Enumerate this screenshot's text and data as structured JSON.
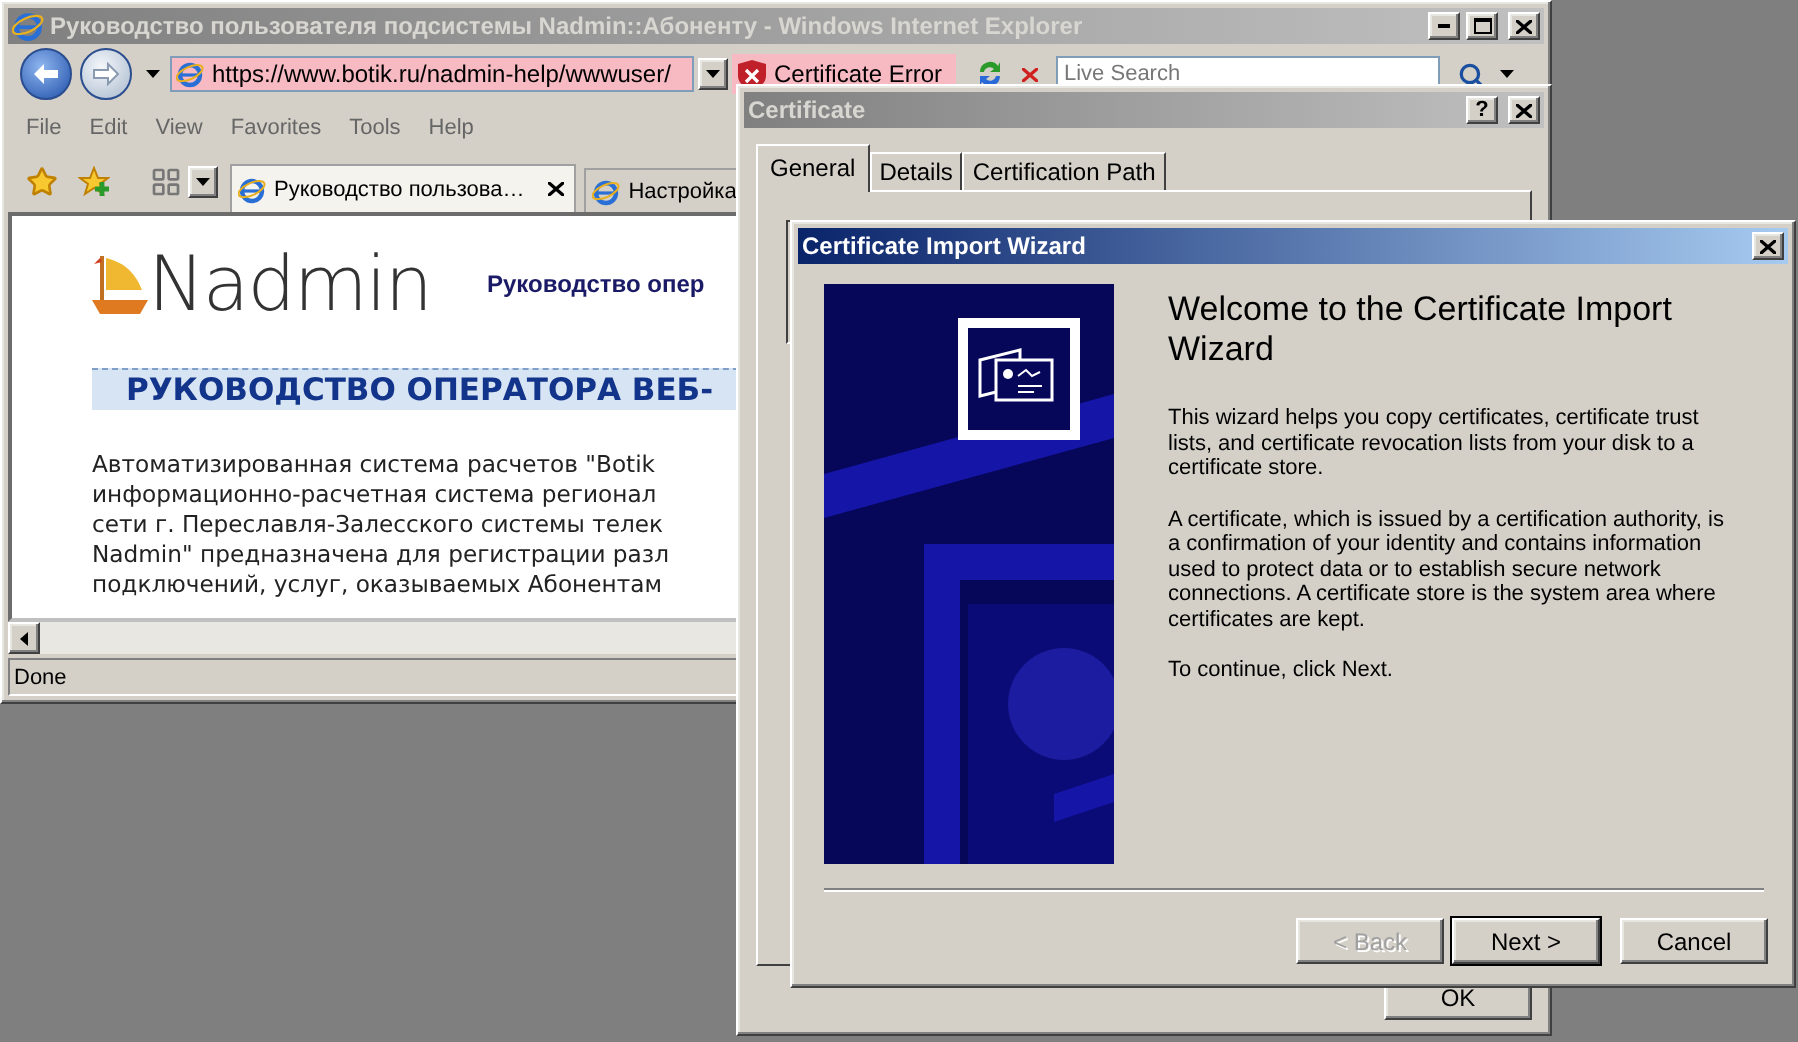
{
  "browser": {
    "title": "Руководство пользователя подсистемы Nadmin::Абоненту - Windows Internet Explorer",
    "address": "https://www.botik.ru/nadmin-help/wwwuser/",
    "cert_error": "Certificate Error",
    "search": {
      "placeholder": "Live Search"
    },
    "menu": [
      "File",
      "Edit",
      "View",
      "Favorites",
      "Tools",
      "Help"
    ],
    "tabs": [
      {
        "label": "Руководство пользова…",
        "selected": true
      },
      {
        "label": "Настройка",
        "selected": false
      }
    ],
    "page": {
      "logo": "Nadmin",
      "header": "Руководство опер",
      "heading": "РУКОВОДСТВО ОПЕРАТОРА ВЕБ-",
      "paragraph_lines": [
        "Автоматизированная система расчетов \"Botik",
        "информационно-расчетная система регионал",
        "сети г. Переславля-Залесского системы телек",
        "Nadmin\" предназначена для регистрации разл",
        "подключений, услуг, оказываемых Абонентам"
      ]
    },
    "status": "Done"
  },
  "certificate_dialog": {
    "title": "Certificate",
    "help": "?",
    "tabs": [
      {
        "label": "General",
        "selected": true
      },
      {
        "label": "Details",
        "selected": false
      },
      {
        "label": "Certification Path",
        "selected": false
      }
    ],
    "buttons": [
      "OK"
    ]
  },
  "wizard": {
    "title": "Certificate Import Wizard",
    "heading": "Welcome to the Certificate Import Wizard",
    "paragraphs": [
      "This wizard helps you copy certificates, certificate trust lists, and certificate revocation lists from your disk to a certificate store.",
      "A certificate, which is issued by a certification authority, is a confirmation of your identity and contains information used to protect data or to establish secure network connections. A certificate store is the system area where certificates are kept.",
      "To continue, click Next."
    ],
    "buttons": [
      {
        "label": "< Back",
        "disabled": true,
        "default": false
      },
      {
        "label": "Next >",
        "disabled": false,
        "default": true
      },
      {
        "label": "Cancel",
        "disabled": false,
        "default": false
      }
    ]
  }
}
